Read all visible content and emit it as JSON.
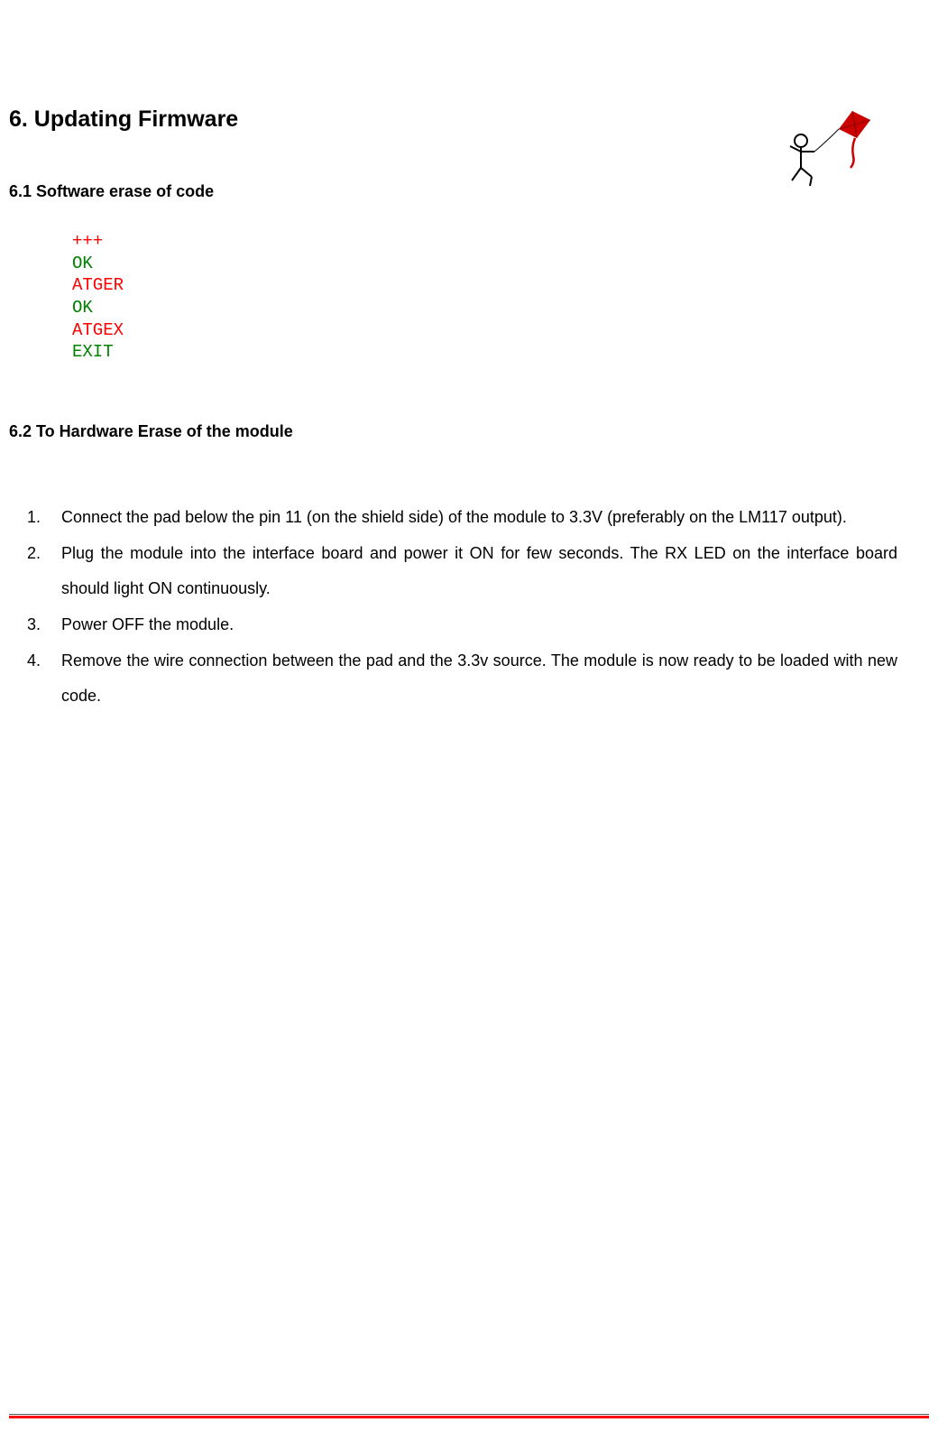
{
  "headings": {
    "section": "6. Updating Firmware",
    "sub1": "6.1 Software erase of code",
    "sub2": "6.2 To Hardware Erase of the module"
  },
  "code_lines": {
    "l1": "+++",
    "l2": "OK",
    "l3": "ATGER",
    "l4": "OK",
    "l5": "ATGEX",
    "l6": "EXIT"
  },
  "steps": {
    "s1": "Connect the pad below the pin 11 (on the shield side) of the module to 3.3V (preferably on the LM117 output).",
    "s2": "Plug the module into the interface board and power it ON for few seconds. The RX LED on the interface board should light ON continuously.",
    "s3": "Power OFF the module.",
    "s4": "Remove the wire connection between the pad and the 3.3v source. The module is now ready to be loaded with new code."
  }
}
